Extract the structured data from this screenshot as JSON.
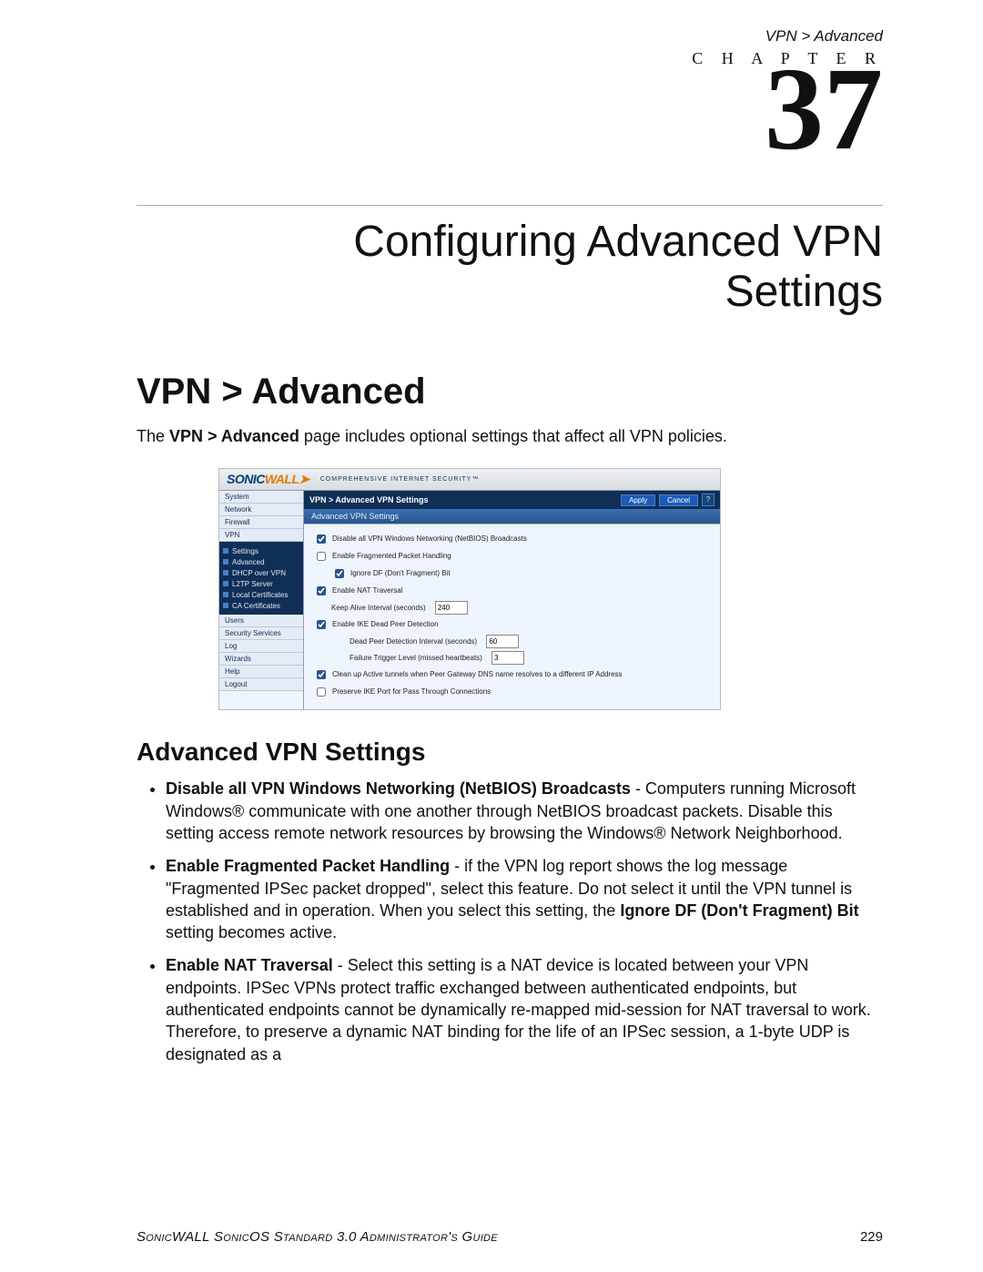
{
  "running_header": "VPN > Advanced",
  "chapter": {
    "label": "C H A P T E R",
    "number": "37",
    "title_line1": "Configuring Advanced VPN",
    "title_line2": "Settings"
  },
  "section": {
    "title": "VPN > Advanced",
    "intro_pre": "The ",
    "intro_bold": "VPN > Advanced",
    "intro_post": " page includes optional settings that affect all VPN policies."
  },
  "screenshot": {
    "logo": {
      "part1": "SONIC",
      "part2": "WALL"
    },
    "tagline": "COMPREHENSIVE INTERNET SECURITY™",
    "sidebar_top": [
      "System",
      "Network",
      "Firewall",
      "VPN"
    ],
    "sidebar_sub": [
      "Settings",
      "Advanced",
      "DHCP over VPN",
      "L2TP Server",
      "Local Certificates",
      "CA Certificates"
    ],
    "sidebar_bottom": [
      "Users",
      "Security Services",
      "Log",
      "Wizards",
      "Help",
      "Logout"
    ],
    "page_title": "VPN > Advanced VPN Settings",
    "buttons": {
      "apply": "Apply",
      "cancel": "Cancel",
      "help": "?"
    },
    "section_header": "Advanced VPN Settings",
    "rows": {
      "r1": {
        "label": "Disable all VPN Windows Networking (NetBIOS) Broadcasts",
        "checked": true
      },
      "r2": {
        "label": "Enable Fragmented Packet Handling",
        "checked": false
      },
      "r3": {
        "label": "Ignore DF (Don't Fragment) Bit",
        "checked": true
      },
      "r4": {
        "label": "Enable NAT Traversal",
        "checked": true
      },
      "r5": {
        "label": "Keep Alive Interval (seconds)",
        "value": "240"
      },
      "r6": {
        "label": "Enable IKE Dead Peer Detection",
        "checked": true
      },
      "r7": {
        "label": "Dead Peer Detection Interval (seconds)",
        "value": "60"
      },
      "r8": {
        "label": "Failure Trigger Level (missed heartbeats)",
        "value": "3"
      },
      "r9": {
        "label": "Clean up Active tunnels when Peer Gateway DNS name resolves to a different IP Address",
        "checked": true
      },
      "r10": {
        "label": "Preserve IKE Port for Pass Through Connections",
        "checked": false
      }
    }
  },
  "subsection": {
    "title": "Advanced VPN Settings"
  },
  "bullets": [
    {
      "bold": "Disable all VPN Windows Networking (NetBIOS) Broadcasts",
      "rest": " - Computers running Microsoft Windows® communicate with one another through NetBIOS broadcast packets. Disable this setting access remote network resources by browsing the Windows® Network Neighborhood."
    },
    {
      "bold": "Enable Fragmented Packet Handling",
      "rest": " - if the VPN log report shows the log message \"Fragmented IPSec packet dropped\", select this feature. Do not select it until the VPN tunnel is established and in operation. When you select this setting, the ",
      "bold2": "Ignore DF (Don't Fragment) Bit",
      "rest2": " setting becomes active."
    },
    {
      "bold": "Enable NAT Traversal",
      "rest": " - Select this setting is a NAT device is located between your VPN endpoints. IPSec VPNs protect traffic exchanged between authenticated endpoints, but authenticated endpoints cannot be dynamically re-mapped mid-session for NAT traversal to work. Therefore, to preserve a dynamic NAT binding for the life of an IPSec session, a 1-byte UDP is designated as a"
    }
  ],
  "footer": {
    "left": "SonicWALL SonicOS Standard 3.0 Administrator's Guide",
    "page": "229"
  }
}
